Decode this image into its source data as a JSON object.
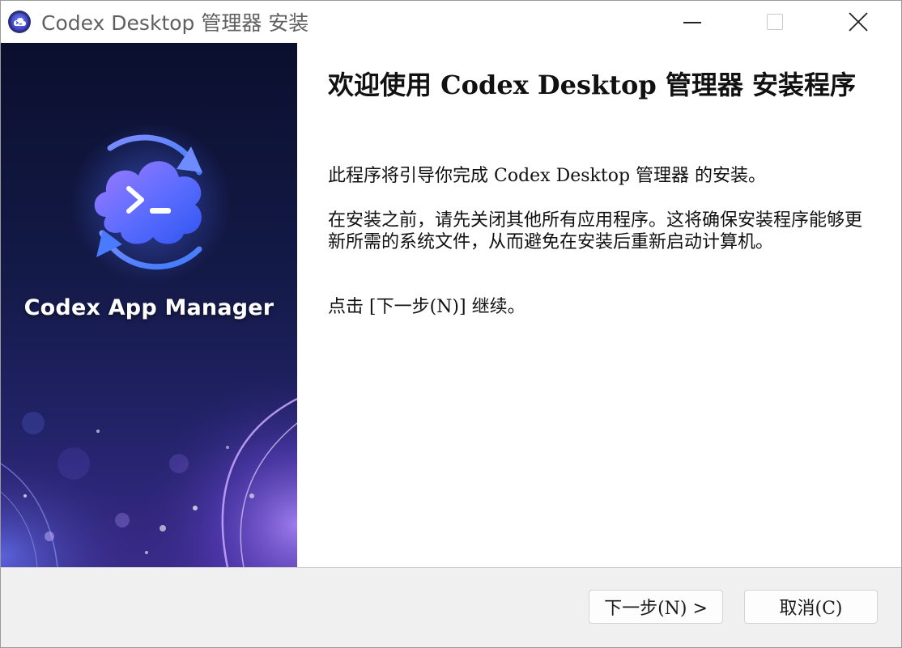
{
  "window": {
    "title": "Codex Desktop 管理器 安装"
  },
  "banner": {
    "product_name": "Codex App Manager"
  },
  "content": {
    "heading": "欢迎使用 Codex Desktop 管理器 安装程序",
    "paragraphs": [
      "此程序将引导你完成 Codex Desktop 管理器 的安装。",
      "在安装之前，请先关闭其他所有应用程序。这将确保安装程序能够更新所需的系统文件，从而避免在安装后重新启动计算机。",
      "点击 [下一步(N)] 继续。"
    ]
  },
  "footer": {
    "next_label": "下一步(N) >",
    "cancel_label": "取消(C)"
  },
  "colors": {
    "banner_top": "#0b0f2e",
    "banner_mid": "#1b1f5c",
    "banner_bottom": "#3a2a8a",
    "logo_blue": "#3d7bff",
    "logo_purple": "#8a5cff",
    "footer_bg": "#f0f0f0"
  },
  "icons": {
    "app": "codex-cloud-terminal-icon",
    "minimize": "minimize-icon",
    "maximize": "maximize-icon",
    "close": "close-icon",
    "logo": "cloud-terminal-sync-logo"
  }
}
